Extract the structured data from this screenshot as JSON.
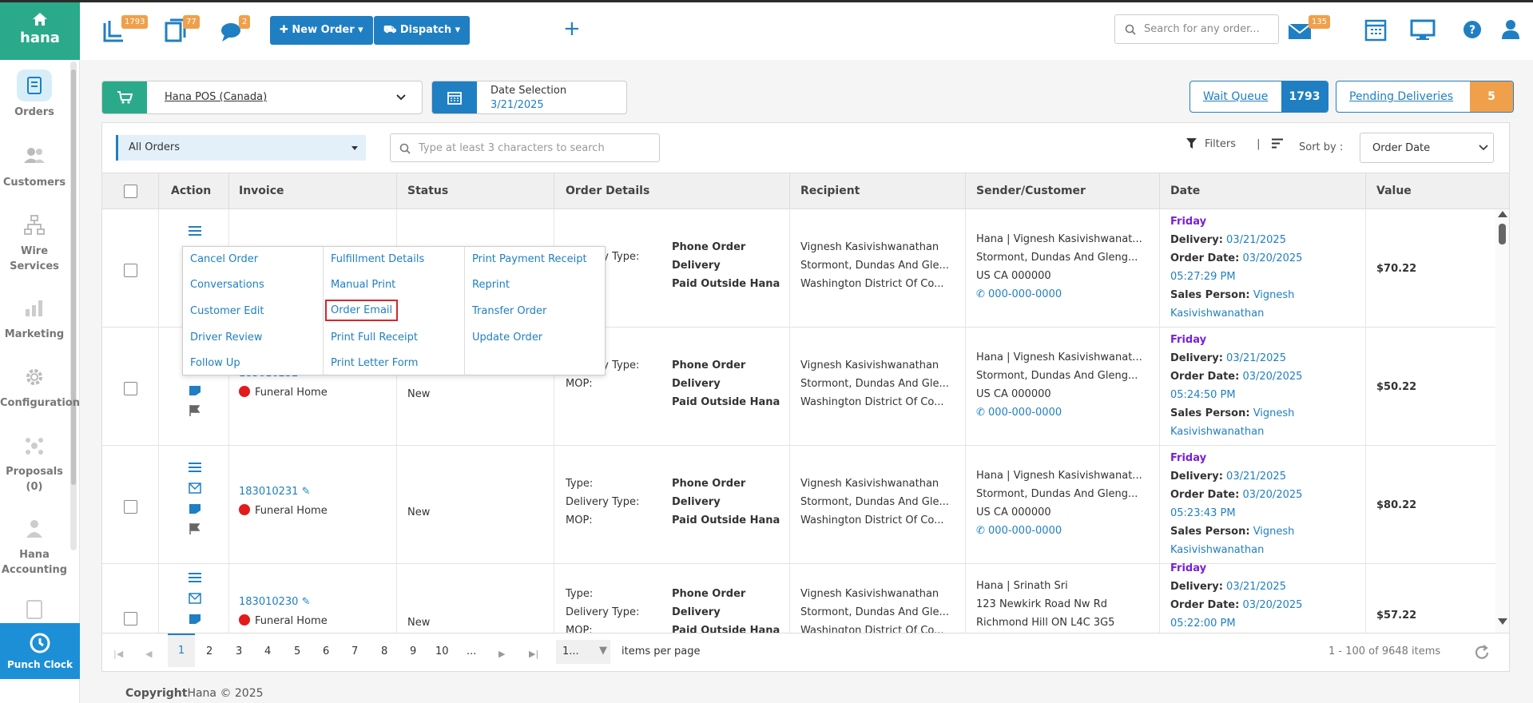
{
  "brand": {
    "name": "hana"
  },
  "sidebar": {
    "items": [
      {
        "label": "Orders",
        "icon": "orders-icon"
      },
      {
        "label": "Customers",
        "icon": "customers-icon"
      },
      {
        "label": "Wire Services",
        "icon": "wire-services-icon"
      },
      {
        "label": "Marketing",
        "icon": "marketing-icon"
      },
      {
        "label": "Configuration",
        "icon": "configuration-icon"
      },
      {
        "label": "Proposals (0)",
        "icon": "proposals-icon"
      },
      {
        "label": "Hana Accounting",
        "icon": "accounting-icon"
      }
    ],
    "punch_clock": "Punch Clock"
  },
  "topbar": {
    "badges": {
      "queue": "1793",
      "orders": "77",
      "chat": "2",
      "mail": "135"
    },
    "new_order": "New Order",
    "dispatch": "Dispatch",
    "search_placeholder": "Search for any order..."
  },
  "toolbar": {
    "store": "Hana POS (Canada)",
    "date_label": "Date Selection",
    "date_value": "3/21/2025",
    "wait_queue": "Wait Queue",
    "wait_queue_count": "1793",
    "pending_deliveries": "Pending Deliveries",
    "pending_count": "5"
  },
  "filters": {
    "view": "All Orders",
    "search_placeholder": "Type at least 3 characters to search",
    "filters_label": "Filters",
    "separator": "|",
    "sort_label": "Sort by :",
    "sort_value": "Order Date"
  },
  "columns": [
    "Action",
    "Invoice",
    "Status",
    "Order Details",
    "Recipient",
    "Sender/Customer",
    "Date",
    "Value"
  ],
  "rows": [
    {
      "invoice": "",
      "type_label": "",
      "status": "",
      "details": {
        "type_label": "",
        "delivery_label": "Delivery Type:",
        "mop_label": "",
        "type": "Phone Order",
        "delivery": "Delivery",
        "mop": "Paid Outside Hana"
      },
      "recipient": [
        "Vignesh Kasivishwanathan",
        "Stormont, Dundas And Gle...",
        "Washington District Of Co..."
      ],
      "sender": [
        "Hana | Vignesh Kasivishwanat...",
        "Stormont, Dundas And Gleng...",
        "US CA 000000",
        "000-000-0000"
      ],
      "date": {
        "day": "Friday",
        "delivery_label": "Delivery:",
        "delivery": "03/21/2025",
        "order_label": "Order Date:",
        "order": "03/20/2025",
        "time": "05:27:29 PM",
        "sales_label": "Sales Person:",
        "sales": "Vignesh",
        "sales2": "Kasivishwanathan"
      },
      "value": "$70.22"
    },
    {
      "invoice": "183010232",
      "category": "Funeral Home",
      "status": "New",
      "details": {
        "type_label": "",
        "delivery_label": "Delivery Type:",
        "mop_label": "MOP:",
        "type": "Phone Order",
        "delivery": "Delivery",
        "mop": "Paid Outside Hana"
      },
      "recipient": [
        "Vignesh Kasivishwanathan",
        "Stormont, Dundas And Gle...",
        "Washington District Of Co..."
      ],
      "sender": [
        "Hana | Vignesh Kasivishwanat...",
        "Stormont, Dundas And Gleng...",
        "US CA 000000",
        "000-000-0000"
      ],
      "date": {
        "day": "Friday",
        "delivery_label": "Delivery:",
        "delivery": "03/21/2025",
        "order_label": "Order Date:",
        "order": "03/20/2025",
        "time": "05:24:50 PM",
        "sales_label": "Sales Person:",
        "sales": "Vignesh",
        "sales2": "Kasivishwanathan"
      },
      "value": "$50.22"
    },
    {
      "invoice": "183010231",
      "category": "Funeral Home",
      "status": "New",
      "details": {
        "type_label": "Type:",
        "delivery_label": "Delivery Type:",
        "mop_label": "MOP:",
        "type": "Phone Order",
        "delivery": "Delivery",
        "mop": "Paid Outside Hana"
      },
      "recipient": [
        "Vignesh Kasivishwanathan",
        "Stormont, Dundas And Gle...",
        "Washington District Of Co..."
      ],
      "sender": [
        "Hana | Vignesh Kasivishwanat...",
        "Stormont, Dundas And Gleng...",
        "US CA 000000",
        "000-000-0000"
      ],
      "date": {
        "day": "Friday",
        "delivery_label": "Delivery:",
        "delivery": "03/21/2025",
        "order_label": "Order Date:",
        "order": "03/20/2025",
        "time": "05:23:43 PM",
        "sales_label": "Sales Person:",
        "sales": "Vignesh",
        "sales2": "Kasivishwanathan"
      },
      "value": "$80.22"
    },
    {
      "invoice": "183010230",
      "category": "Funeral Home",
      "status": "New",
      "details": {
        "type_label": "Type:",
        "delivery_label": "Delivery Type:",
        "mop_label": "MOP:",
        "type": "Phone Order",
        "delivery": "Delivery",
        "mop": "Paid Outside Hana"
      },
      "recipient": [
        "Vignesh Kasivishwanathan",
        "Stormont, Dundas And Gle...",
        "Washington District Of Co..."
      ],
      "sender": [
        "Hana | Srinath Sri",
        "123 Newkirk Road Nw Rd",
        "Richmond Hill ON L4C 3G5",
        ""
      ],
      "date": {
        "day": "Friday",
        "delivery_label": "Delivery:",
        "delivery": "03/21/2025",
        "order_label": "Order Date:",
        "order": "03/20/2025",
        "time": "05:22:00 PM",
        "sales_label": "",
        "sales": "",
        "sales2": ""
      },
      "value": "$57.22"
    }
  ],
  "action_menu": {
    "col1": [
      "Cancel Order",
      "Conversations",
      "Customer Edit",
      "Driver Review",
      "Follow Up"
    ],
    "col2": [
      "Fulfillment Details",
      "Manual Print",
      "Order Email",
      "Print Full Receipt",
      "Print Letter Form"
    ],
    "col3": [
      "Print Payment Receipt",
      "Reprint",
      "Transfer Order",
      "Update Order"
    ],
    "highlighted": "Order Email"
  },
  "pager": {
    "pages": [
      "1",
      "2",
      "3",
      "4",
      "5",
      "6",
      "7",
      "8",
      "9",
      "10",
      "..."
    ],
    "per_page": "1...",
    "per_page_label": "items per page",
    "summary": "1 - 100 of 9648 items"
  },
  "footer": {
    "copyright": "Copyright",
    "text": "Hana © 2025"
  }
}
